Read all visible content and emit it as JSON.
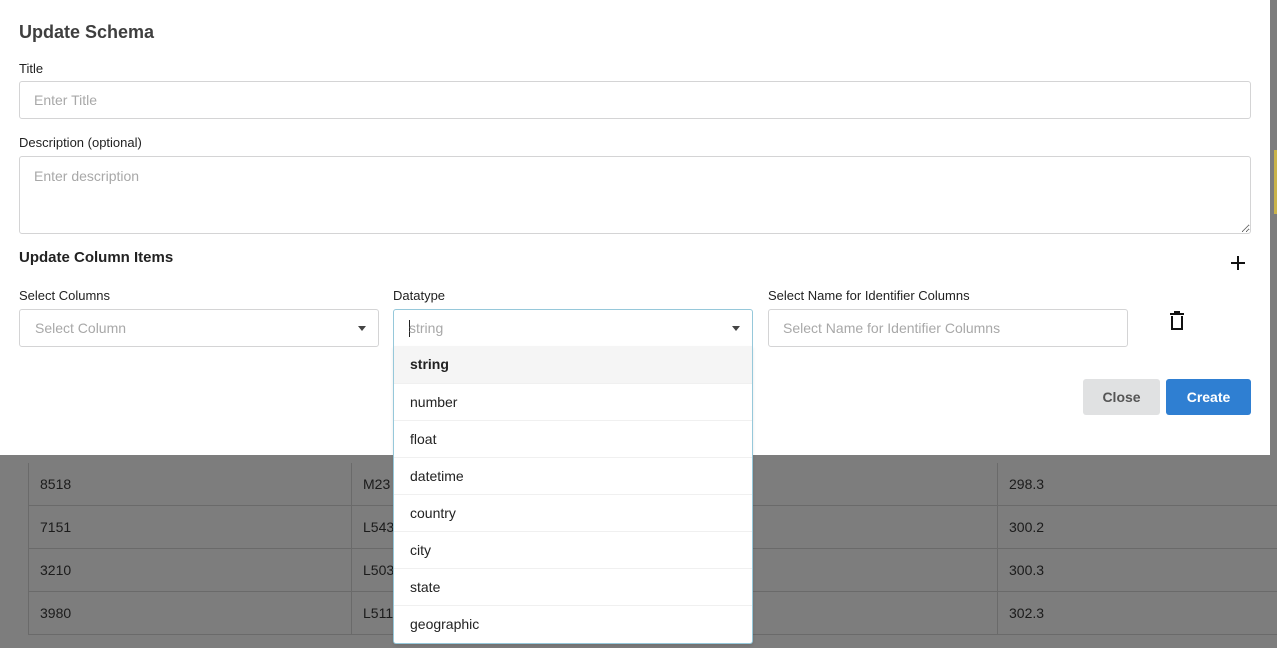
{
  "modal": {
    "title": "Update Schema",
    "title_label": "Title",
    "title_placeholder": "Enter Title",
    "description_label": "Description (optional)",
    "description_placeholder": "Enter description",
    "columns_section_title": "Update Column Items",
    "select_columns_label": "Select Columns",
    "select_columns_placeholder": "Select Column",
    "datatype_label": "Datatype",
    "datatype_value": "string",
    "identifier_label": "Select Name for Identifier Columns",
    "identifier_placeholder": "Select Name for Identifier Columns",
    "close_label": "Close",
    "create_label": "Create"
  },
  "datatype_options": [
    "string",
    "number",
    "float",
    "datetime",
    "country",
    "city",
    "state",
    "geographic"
  ],
  "background_table": {
    "rows": [
      [
        "8518",
        "M23",
        "298.3"
      ],
      [
        "7151",
        "L543",
        "300.2"
      ],
      [
        "3210",
        "L503",
        "300.3"
      ],
      [
        "3980",
        "L511",
        "302.3"
      ]
    ]
  },
  "colors": {
    "primary": "#2f7fd2",
    "close_button": "#e0e1e2",
    "overlay": "#7d7d7d",
    "dropdown_border": "#96c8da"
  }
}
